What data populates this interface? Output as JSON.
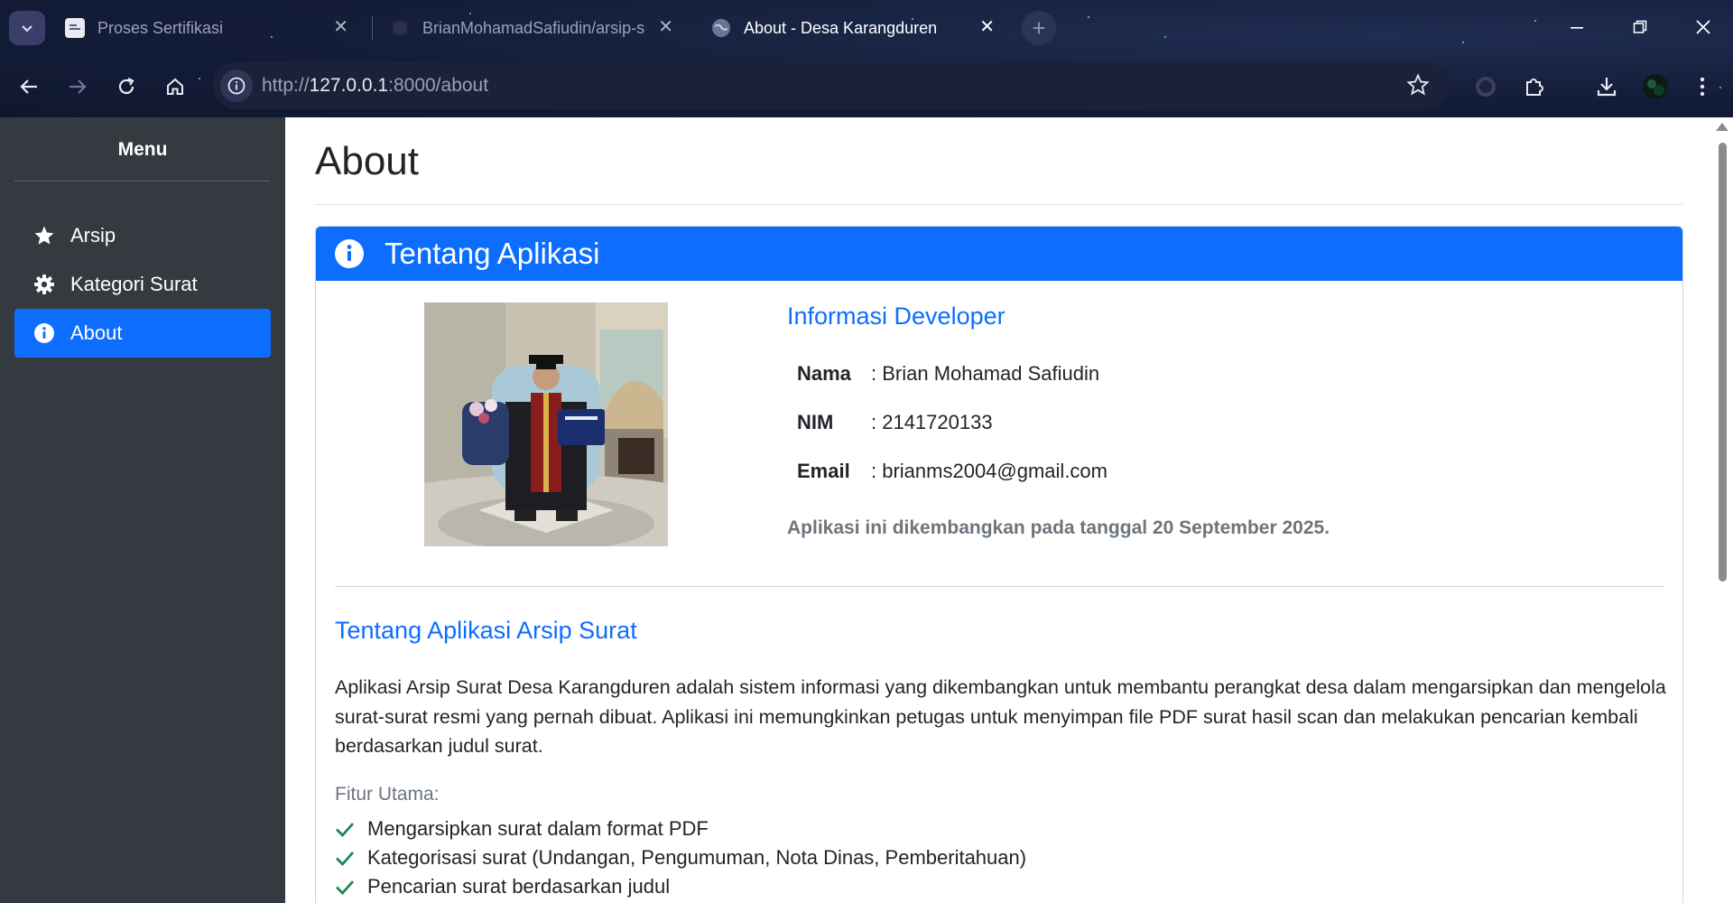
{
  "browser": {
    "tabs": [
      {
        "title": "Proses Sertifikasi",
        "active": false
      },
      {
        "title": "BrianMohamadSafiudin/arsip-s",
        "active": false
      },
      {
        "title": "About - Desa Karangduren",
        "active": true
      }
    ],
    "url": {
      "scheme": "http://",
      "host": "127.0.0.1",
      "rest": ":8000/about"
    }
  },
  "sidebar": {
    "title": "Menu",
    "items": [
      {
        "label": "Arsip",
        "icon": "star-icon",
        "active": false
      },
      {
        "label": "Kategori Surat",
        "icon": "gear-icon",
        "active": false
      },
      {
        "label": "About",
        "icon": "info-icon",
        "active": true
      }
    ]
  },
  "page": {
    "title": "About",
    "card_header": "Tentang Aplikasi",
    "developer": {
      "heading": "Informasi Developer",
      "rows": [
        {
          "key": "Nama",
          "value": ": Brian Mohamad Safiudin"
        },
        {
          "key": "NIM",
          "value": ": 2141720133"
        },
        {
          "key": "Email",
          "value": ": brianms2004@gmail.com"
        }
      ],
      "note": "Aplikasi ini dikembangkan pada tanggal 20 September 2025."
    },
    "about": {
      "heading": "Tentang Aplikasi Arsip Surat",
      "description": "Aplikasi Arsip Surat Desa Karangduren adalah sistem informasi yang dikembangkan untuk membantu perangkat desa dalam mengarsipkan dan mengelola surat-surat resmi yang pernah dibuat. Aplikasi ini memungkinkan petugas untuk menyimpan file PDF surat hasil scan dan melakukan pencarian kembali berdasarkan judul surat.",
      "features_label": "Fitur Utama:",
      "features": [
        "Mengarsipkan surat dalam format PDF",
        "Kategorisasi surat (Undangan, Pengumuman, Nota Dinas, Pemberitahuan)",
        "Pencarian surat berdasarkan judul"
      ]
    }
  },
  "colors": {
    "primary": "#0d6efd",
    "sidebar": "#343a40",
    "check": "#198754"
  }
}
